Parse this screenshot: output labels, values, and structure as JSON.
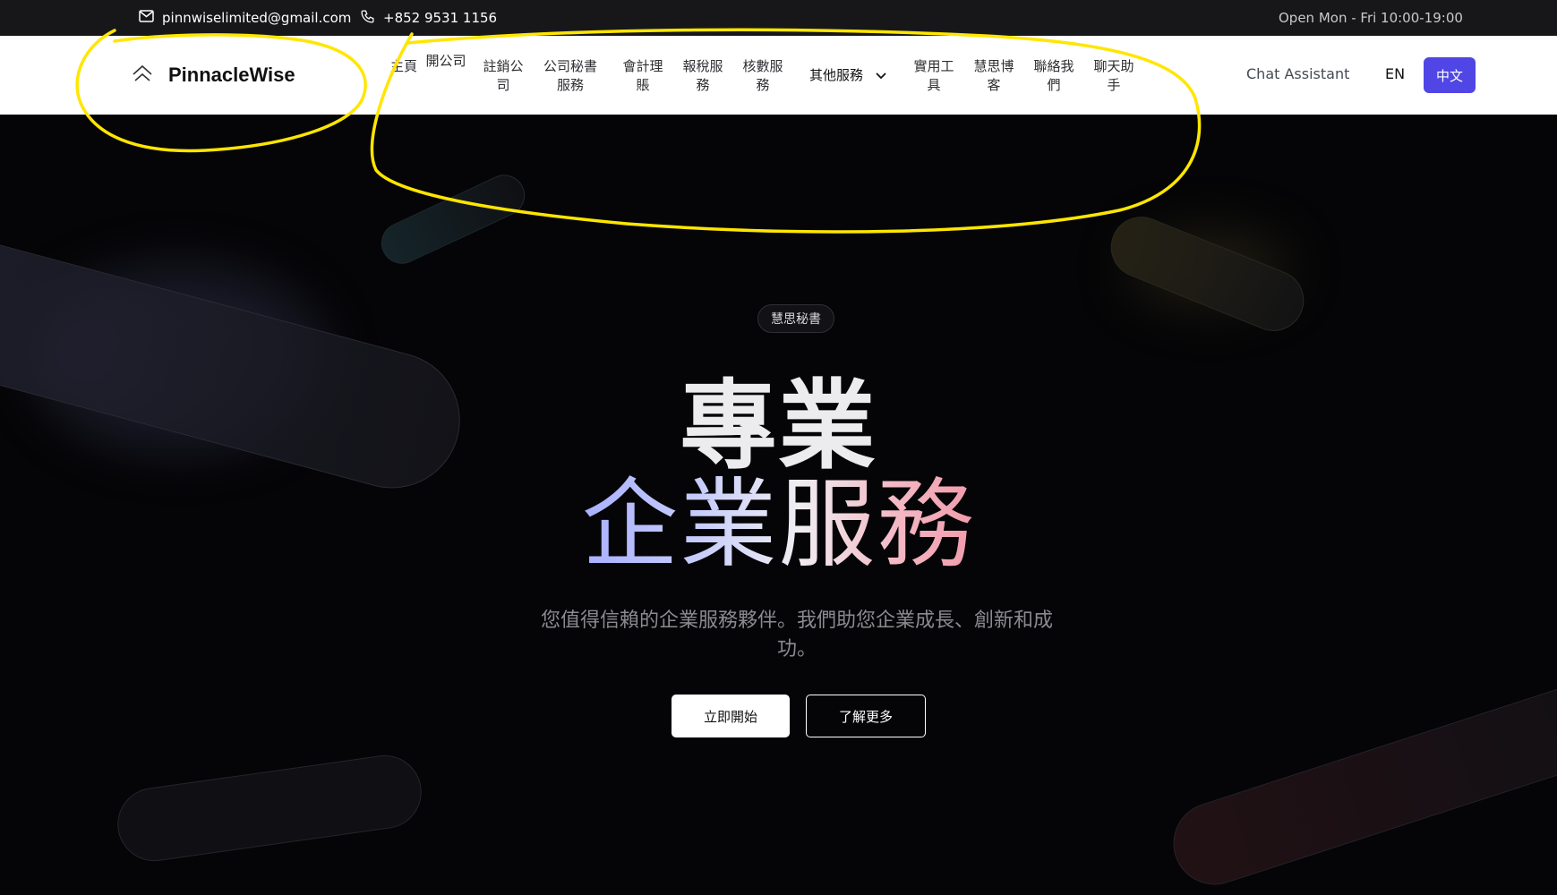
{
  "topbar": {
    "email": "pinnwiselimited@gmail.com",
    "phone": "+852 9531 1156",
    "hours": "Open Mon - Fri 10:00-19:00"
  },
  "brand": {
    "name": "PinnacleWise"
  },
  "nav": {
    "items": [
      {
        "label": "主頁"
      },
      {
        "label": "開公司"
      },
      {
        "label": "註銷公司"
      },
      {
        "label": "公司秘書服務"
      },
      {
        "label": "會計理賬"
      },
      {
        "label": "報稅服務"
      },
      {
        "label": "核數服務"
      },
      {
        "label": "其他服務"
      },
      {
        "label": "實用工具"
      },
      {
        "label": "慧思博客"
      },
      {
        "label": "聯絡我們"
      },
      {
        "label": "聊天助手"
      }
    ],
    "chat_assistant": "Chat Assistant",
    "lang_en": "EN",
    "lang_zh": "中文"
  },
  "hero": {
    "badge": "慧思秘書",
    "title_line1": "專業",
    "title_line2": "企業服務",
    "subtitle": "您值得信賴的企業服務夥伴。我們助您企業成長、創新和成功。",
    "primary_button": "立即開始",
    "secondary_button": "了解更多"
  },
  "colors": {
    "accent": "#5046e5",
    "annotation": "#ffe600",
    "background": "#050507"
  }
}
